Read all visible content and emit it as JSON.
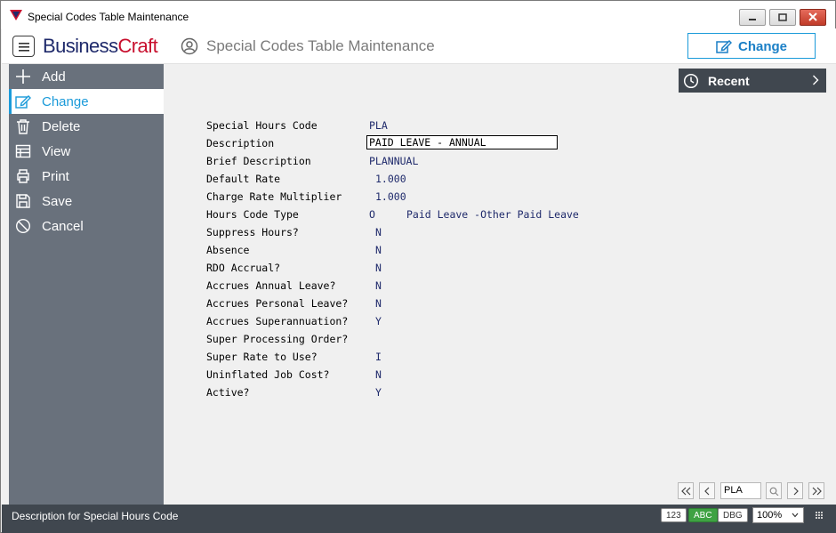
{
  "window": {
    "title": "Special Codes Table Maintenance"
  },
  "header": {
    "logo_part1": "Business",
    "logo_part2": "Craft",
    "page_title": "Special Codes Table Maintenance",
    "mode_button": "Change"
  },
  "sidebar": {
    "items": [
      {
        "label": "Add",
        "icon": "plus-icon"
      },
      {
        "label": "Change",
        "icon": "edit-icon",
        "active": true
      },
      {
        "label": "Delete",
        "icon": "trash-icon"
      },
      {
        "label": "View",
        "icon": "table-icon"
      },
      {
        "label": "Print",
        "icon": "printer-icon"
      },
      {
        "label": "Save",
        "icon": "save-icon"
      },
      {
        "label": "Cancel",
        "icon": "cancel-icon"
      }
    ]
  },
  "recent": {
    "label": "Recent"
  },
  "form": {
    "fields": [
      {
        "label": "Special Hours Code",
        "value": "PLA"
      },
      {
        "label": "Description",
        "value": "PAID LEAVE - ANNUAL"
      },
      {
        "label": "Brief Description",
        "value": "PLANNUAL"
      },
      {
        "label": "Default Rate",
        "value": "1.000"
      },
      {
        "label": "Charge Rate Multiplier",
        "value": "1.000"
      },
      {
        "label": "Hours Code Type",
        "value": "O",
        "extra": "Paid Leave -Other Paid Leave"
      },
      {
        "label": "Suppress Hours?",
        "value": "N"
      },
      {
        "label": "Absence",
        "value": "N"
      },
      {
        "label": "RDO Accrual?",
        "value": "N"
      },
      {
        "label": "Accrues Annual Leave?",
        "value": "N"
      },
      {
        "label": "Accrues Personal Leave?",
        "value": "N"
      },
      {
        "label": "Accrues Superannuation?",
        "value": "Y"
      },
      {
        "label": "Super Processing Order?",
        "value": ""
      },
      {
        "label": "Super Rate to Use?",
        "value": "I"
      },
      {
        "label": "Uninflated Job Cost?",
        "value": "N"
      },
      {
        "label": "Active?",
        "value": "Y"
      }
    ]
  },
  "record_nav": {
    "current_value": "PLA"
  },
  "statusbar": {
    "message": "Description for Special Hours Code",
    "pill_123": "123",
    "pill_abc": "ABC",
    "pill_dbg": "DBG",
    "zoom": "100%"
  },
  "colors": {
    "accent": "#1a9ad9",
    "sidebar_bg": "#69717c",
    "dark_bar": "#40474f",
    "value_text": "#1f2a6b",
    "logo_red": "#c8102e"
  }
}
